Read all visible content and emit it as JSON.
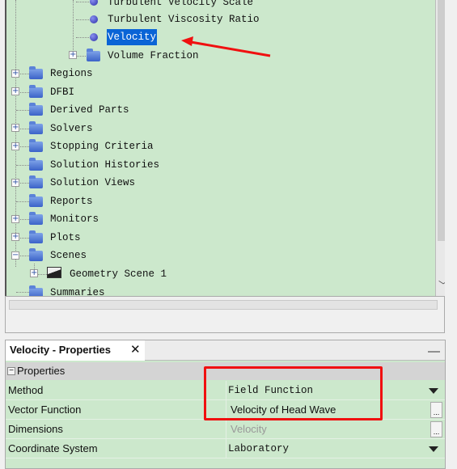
{
  "tree": {
    "items": [
      {
        "label": "Turbulent Velocity Scale",
        "icon": "field-function-dot-icon"
      },
      {
        "label": "Turbulent Viscosity Ratio",
        "icon": "field-function-dot-icon"
      },
      {
        "label": "Velocity",
        "icon": "field-function-dot-icon",
        "selected": true
      },
      {
        "label": "Volume Fraction",
        "icon": "folder-icon",
        "expandable": true
      },
      {
        "label": "Regions",
        "icon": "folder-icon",
        "expandable": true
      },
      {
        "label": "DFBI",
        "icon": "folder-icon",
        "expandable": true
      },
      {
        "label": "Derived Parts",
        "icon": "folder-icon"
      },
      {
        "label": "Solvers",
        "icon": "folder-icon",
        "expandable": true
      },
      {
        "label": "Stopping Criteria",
        "icon": "folder-icon",
        "expandable": true
      },
      {
        "label": "Solution Histories",
        "icon": "folder-icon"
      },
      {
        "label": "Solution Views",
        "icon": "folder-icon",
        "expandable": true
      },
      {
        "label": "Reports",
        "icon": "folder-icon"
      },
      {
        "label": "Monitors",
        "icon": "folder-icon",
        "expandable": true
      },
      {
        "label": "Plots",
        "icon": "folder-icon",
        "expandable": true
      },
      {
        "label": "Scenes",
        "icon": "folder-icon",
        "expanded": true
      },
      {
        "label": "Geometry Scene 1",
        "icon": "scene-icon",
        "expandable": true
      },
      {
        "label": "Summaries",
        "icon": "folder-icon"
      }
    ]
  },
  "properties": {
    "tab_title": "Velocity - Properties",
    "close": "✕",
    "minimize": "—",
    "section": "Properties",
    "rows": [
      {
        "label": "Method",
        "value": "Field Function",
        "control": "dropdown"
      },
      {
        "label": "Vector Function",
        "value": "Velocity of Head Wave",
        "control": "ellipsis"
      },
      {
        "label": "Dimensions",
        "value": "Velocity",
        "control": "ellipsis",
        "disabled": true
      },
      {
        "label": "Coordinate System",
        "value": "Laboratory",
        "control": "dropdown"
      }
    ],
    "ellipsis": "..."
  },
  "annotations": {
    "color": "#f01010"
  },
  "colors": {
    "panel_bg": "#cce8cc",
    "selection": "#0a64d6"
  }
}
